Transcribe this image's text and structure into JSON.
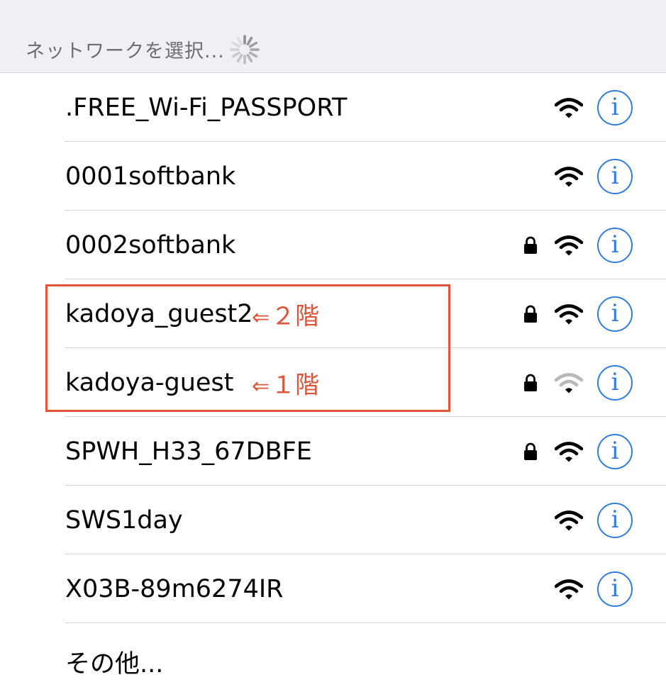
{
  "header": {
    "title": "ネットワークを選択..."
  },
  "networks": [
    {
      "name": ".FREE_Wi-Fi_PASSPORT",
      "locked": false,
      "signal": "full",
      "annotation": ""
    },
    {
      "name": "0001softbank",
      "locked": false,
      "signal": "full",
      "annotation": ""
    },
    {
      "name": "0002softbank",
      "locked": true,
      "signal": "full",
      "annotation": ""
    },
    {
      "name": "kadoya_guest2",
      "locked": true,
      "signal": "full",
      "annotation": "２階"
    },
    {
      "name": "kadoya-guest",
      "locked": true,
      "signal": "weak",
      "annotation": "１階"
    },
    {
      "name": "SPWH_H33_67DBFE",
      "locked": true,
      "signal": "full",
      "annotation": ""
    },
    {
      "name": "SWS1day",
      "locked": false,
      "signal": "full",
      "annotation": ""
    },
    {
      "name": "X03B-89m6274IR",
      "locked": false,
      "signal": "full",
      "annotation": ""
    }
  ],
  "annotation_arrow": "⇐",
  "other_label": "その他...",
  "colors": {
    "accent": "#2f7de1",
    "annotation": "#e0553a",
    "header_bg": "#efeff4"
  },
  "icons": {
    "lock": "lock-icon",
    "wifi": "wifi-icon",
    "info": "info-icon",
    "spinner": "spinner-icon"
  }
}
